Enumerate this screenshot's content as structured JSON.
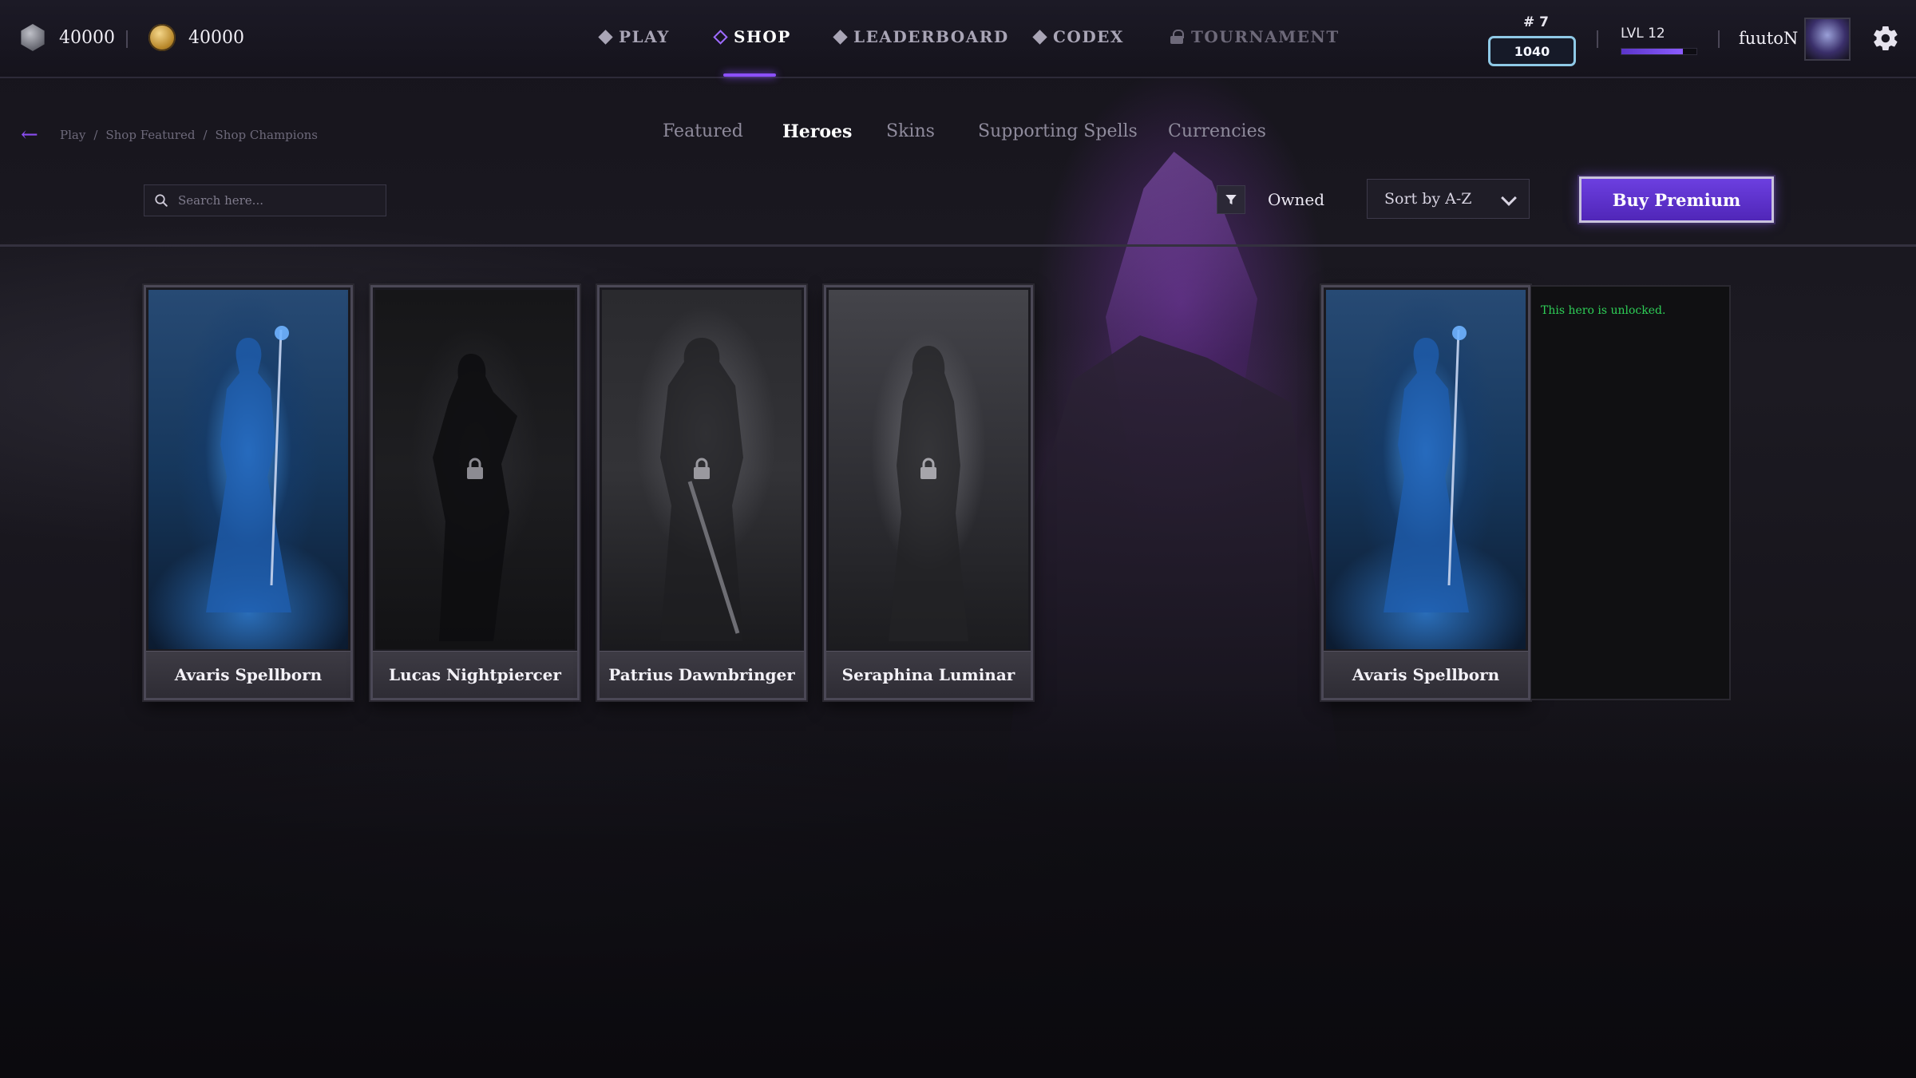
{
  "currencies": [
    {
      "icon": "silver-coin-icon",
      "amount": "40000"
    },
    {
      "icon": "gold-coin-icon",
      "amount": "40000"
    }
  ],
  "nav": {
    "play": "PLAY",
    "shop": "SHOP",
    "leaderboard": "LEADERBOARD",
    "codex": "CODEX",
    "tournament": "TOURNAMENT"
  },
  "player": {
    "rank_label": "# 7",
    "rank_points": "1040",
    "level": "LVL 12",
    "xp_progress": 0.82,
    "username": "fuutoN"
  },
  "breadcrumb": {
    "items": [
      "Play",
      "Shop Featured",
      "Shop Champions"
    ],
    "separator": "/"
  },
  "tabs": {
    "featured": "Featured",
    "heroes": "Heroes",
    "skins": "Skins",
    "supporting_spells": "Supporting Spells",
    "currencies": "Currencies",
    "active": "Heroes"
  },
  "toolbar": {
    "search_placeholder": "Search here...",
    "owned_label": "Owned",
    "sort_value": "Sort by A-Z",
    "premium_label": "Buy Premium"
  },
  "heroes": [
    {
      "name": "Avaris Spellborn",
      "locked": false
    },
    {
      "name": "Lucas Nightpiercer",
      "locked": true
    },
    {
      "name": "Patrius Dawnbringer",
      "locked": true
    },
    {
      "name": "Seraphina Luminar",
      "locked": true
    }
  ],
  "selected_hero": {
    "name": "Avaris Spellborn",
    "status_message": "This hero is unlocked."
  },
  "colors": {
    "accent": "#8c50ff",
    "unlocked_text": "#2ecf57",
    "rank_border": "#8fc9e6"
  }
}
